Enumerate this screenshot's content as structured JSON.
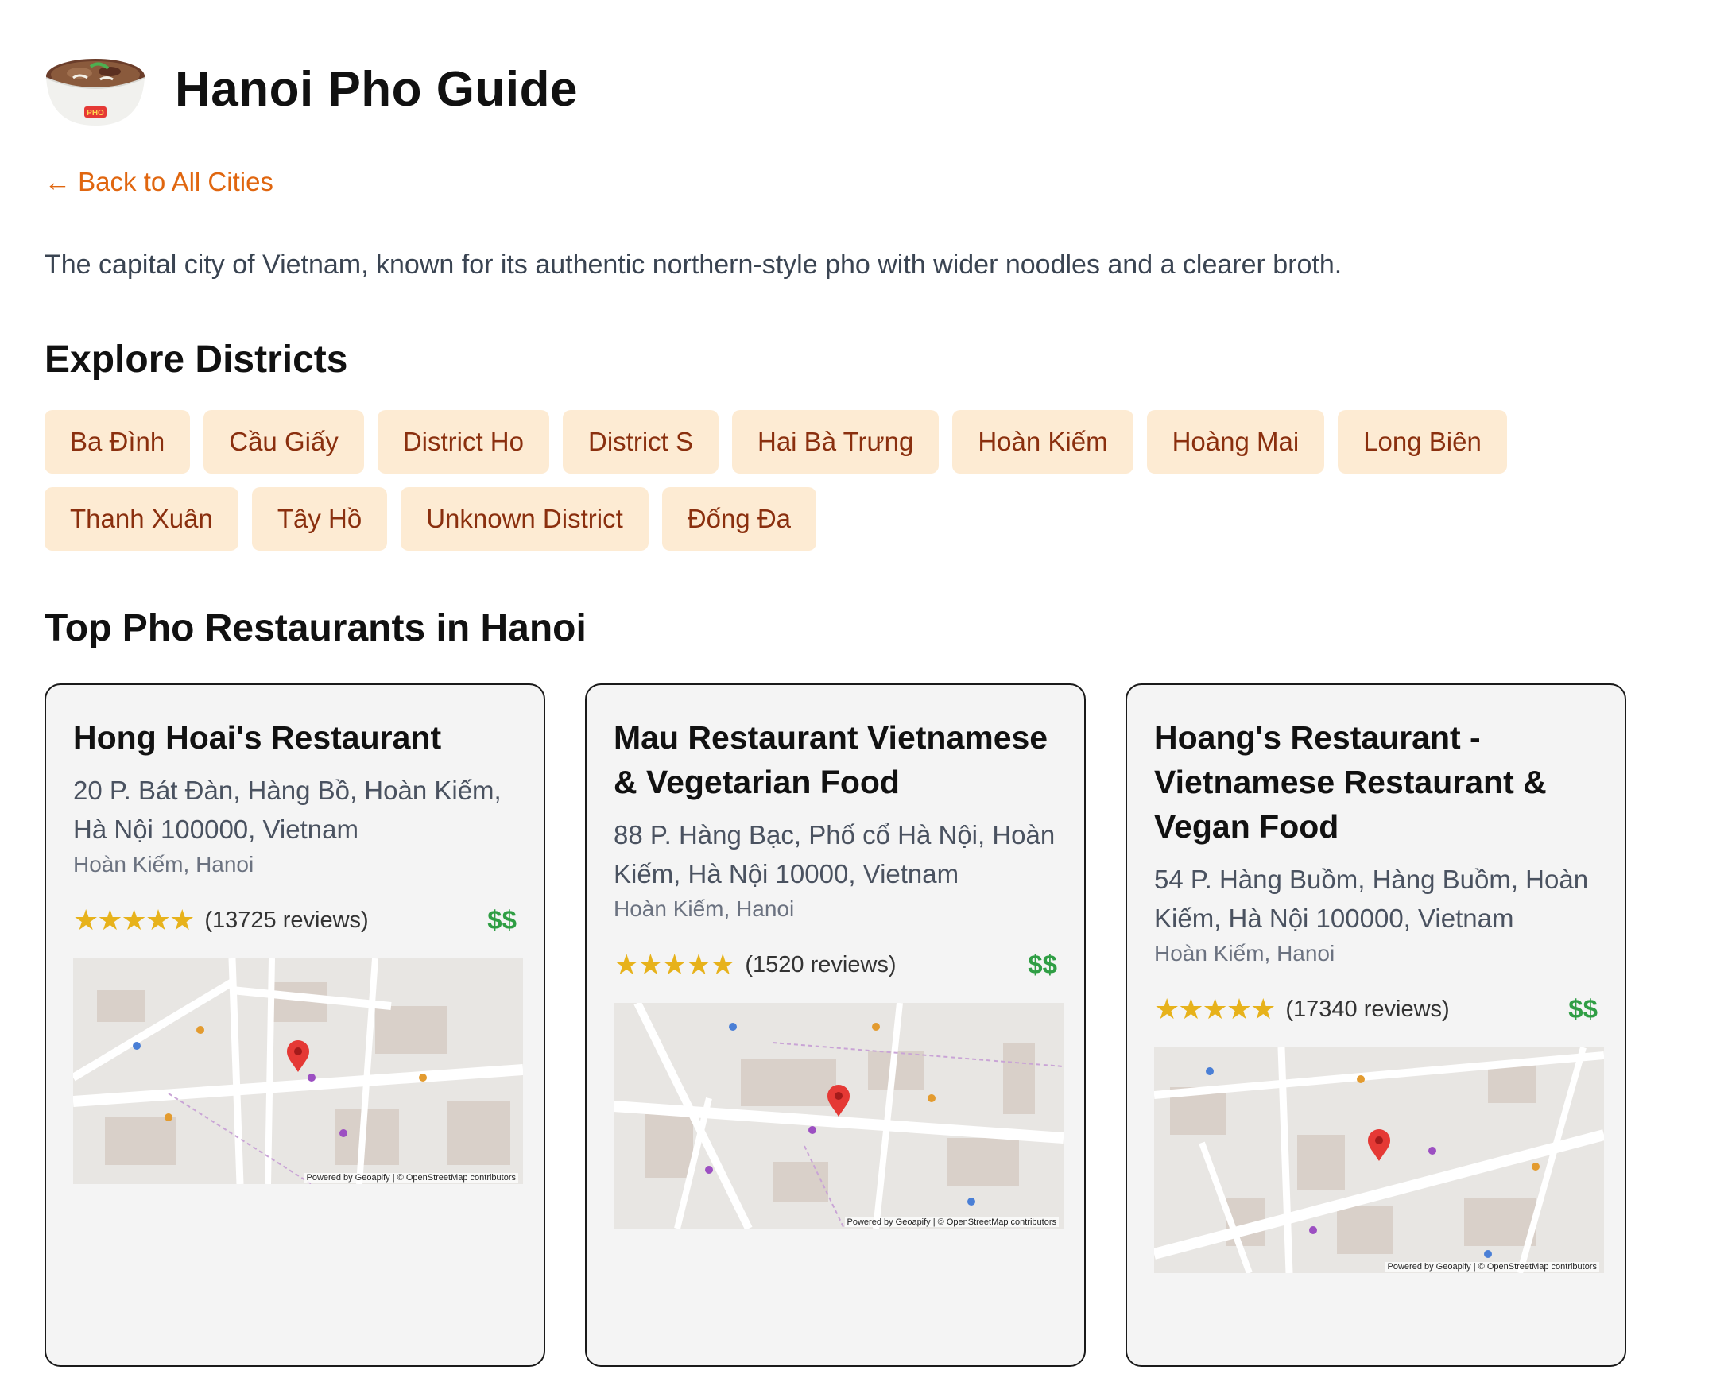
{
  "header": {
    "title": "Hanoi Pho Guide",
    "logo_text": "PHO"
  },
  "nav": {
    "back_label": "← Back to All Cities"
  },
  "intro": "The capital city of Vietnam, known for its authentic northern-style pho with wider noodles and a clearer broth.",
  "districts": {
    "title": "Explore Districts",
    "items": [
      "Ba Đình",
      "Cầu Giấy",
      "District Ho",
      "District S",
      "Hai Bà Trưng",
      "Hoàn Kiếm",
      "Hoàng Mai",
      "Long Biên",
      "Thanh Xuân",
      "Tây Hồ",
      "Unknown District",
      "Đống Đa"
    ]
  },
  "restaurants": {
    "title": "Top Pho Restaurants in Hanoi",
    "items": [
      {
        "name": "Hong Hoai's Restaurant",
        "address": "20 P. Bát Đàn, Hàng Bồ, Hoàn Kiếm, Hà Nội 100000, Vietnam",
        "area": "Hoàn Kiếm, Hanoi",
        "stars": "★★★★★",
        "reviews": "(13725 reviews)",
        "price": "$$",
        "map_credit": "Powered by Geoapify | © OpenStreetMap contributors"
      },
      {
        "name": "Mau Restaurant Vietnamese & Vegetarian Food",
        "address": "88 P. Hàng Bạc, Phố cổ Hà Nội, Hoàn Kiếm, Hà Nội 10000, Vietnam",
        "area": "Hoàn Kiếm, Hanoi",
        "stars": "★★★★★",
        "reviews": "(1520 reviews)",
        "price": "$$",
        "map_credit": "Powered by Geoapify | © OpenStreetMap contributors"
      },
      {
        "name": "Hoang's Restaurant - Vietnamese Restaurant & Vegan Food",
        "address": "54 P. Hàng Buồm, Hàng Buồm, Hoàn Kiếm, Hà Nội 100000, Vietnam",
        "area": "Hoàn Kiếm, Hanoi",
        "stars": "★★★★★",
        "reviews": "(17340 reviews)",
        "price": "$$",
        "map_credit": "Powered by Geoapify | © OpenStreetMap contributors"
      }
    ]
  },
  "colors": {
    "accent": "#e0660f",
    "chip_bg": "#fdebd3",
    "chip_text": "#8a2f0e",
    "star": "#e7b21b",
    "price": "#2f9e44",
    "pin": "#e53935"
  }
}
